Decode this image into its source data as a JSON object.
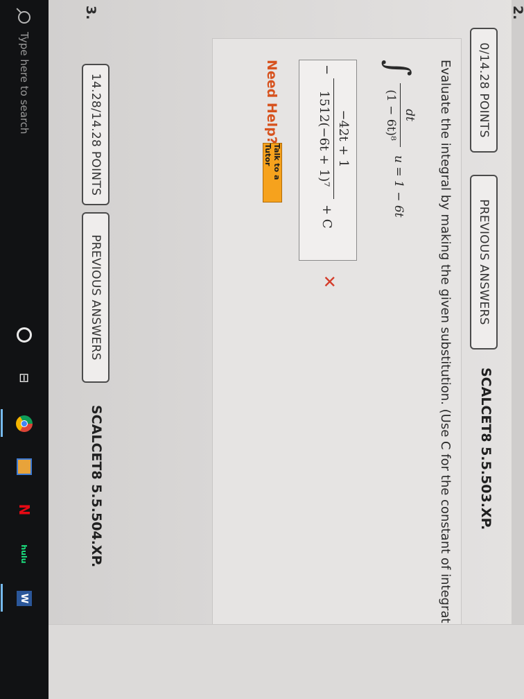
{
  "question2": {
    "number": "2.",
    "points": "0/14.28 POINTS",
    "previous_answers": "PREVIOUS ANSWERS",
    "id": "SCALCET8 5.5.503.XP.",
    "prompt": "Evaluate the integral by making the given substitution. (Use C for the constant of integration.)",
    "integral": {
      "sign": "∫",
      "numerator": "dt",
      "denominator": "(1 − 6t)⁸",
      "substitution": "u = 1 − 6t"
    },
    "answer": {
      "minus": "−",
      "numerator": "−42t + 1",
      "denominator": "1512(−6t + 1)⁷",
      "tail": "+ C"
    },
    "result_icon": "✕",
    "need_help": "Need Help?",
    "tutor_button": "Talk to a Tutor"
  },
  "question3": {
    "number": "3.",
    "points": "14.28/14.28 POINTS",
    "previous_answers": "PREVIOUS ANSWERS",
    "id": "SCALCET8 5.5.504.XP."
  },
  "taskbar": {
    "search_placeholder": "Type here to search",
    "taskview_glyph": "⊟",
    "netflix_glyph": "N",
    "hulu_glyph": "hulu",
    "word_glyph": "W"
  },
  "colors": {
    "need_help": "#d7531f",
    "tutor_button": "#f6a21d",
    "wrong_mark": "#d43c2a",
    "taskbar": "#111214"
  }
}
